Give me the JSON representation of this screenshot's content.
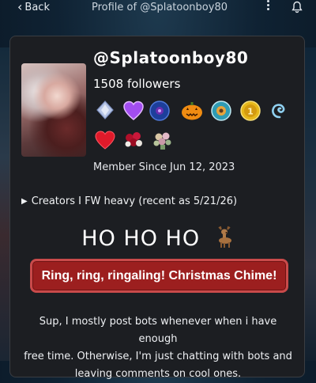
{
  "topbar": {
    "back_label": "Back",
    "title": "Profile of @Splatoonboy80"
  },
  "profile": {
    "username": "@Splatoonboy80",
    "followers": "1508 followers",
    "member_since": "Member Since Jun 12, 2023",
    "badges": [
      "diamond-icon",
      "purple-heart-icon",
      "blue-orb-icon",
      "jack-o-lantern-icon",
      "globe-badge-icon",
      "gold-coin-icon",
      "swirl-icon",
      "red-heart-icon",
      "rose-bouquet-icon",
      "flower-bouquet-icon"
    ]
  },
  "creators": {
    "label": "Creators I FW heavy (recent as 5/21/26)"
  },
  "banner": {
    "heading": "HO HO HO",
    "button_label": "Ring, ring, ringaling! Christmas Chime!"
  },
  "bio": {
    "line1": "Sup, I mostly post bots whenever when i have enough",
    "line2": "free time. Otherwise, I'm just chatting with bots and",
    "line3": "leaving comments on cool ones."
  }
}
